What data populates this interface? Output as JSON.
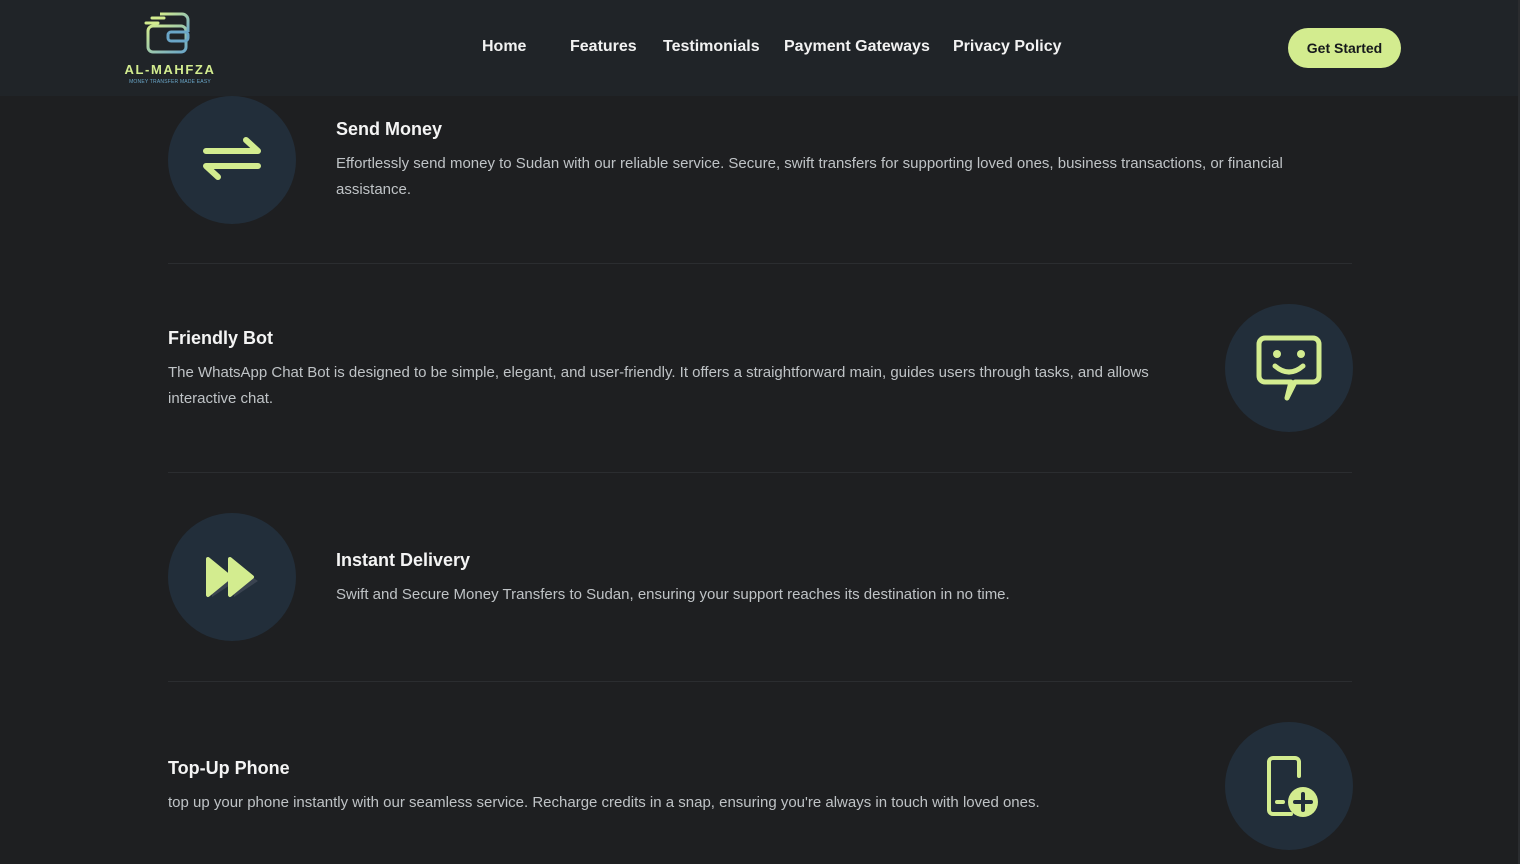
{
  "brand": {
    "name": "AL-MAHFZA",
    "tagline": "MONEY TRANSFER MADE EASY",
    "accent_color": "#d3ec8f",
    "secondary_color": "#6aa6c8"
  },
  "nav": {
    "items": [
      {
        "label": "Home"
      },
      {
        "label": "Features"
      },
      {
        "label": "Testimonials"
      },
      {
        "label": "Payment Gateways"
      },
      {
        "label": "Privacy Policy"
      }
    ],
    "cta_label": "Get Started"
  },
  "features": [
    {
      "title": "Send Money",
      "description": "Effortlessly send money to Sudan with our reliable service. Secure, swift transfers for supporting loved ones, business transactions, or financial assistance.",
      "icon": "transfer-arrows-icon"
    },
    {
      "title": "Friendly Bot",
      "description": "The WhatsApp Chat Bot is designed to be simple, elegant, and user-friendly. It offers a straightforward main, guides users through tasks, and allows interactive chat.",
      "icon": "chat-bot-icon"
    },
    {
      "title": "Instant Delivery",
      "description": "Swift and Secure Money Transfers to Sudan, ensuring your support reaches its destination in no time.",
      "icon": "fast-forward-icon"
    },
    {
      "title": "Top-Up Phone",
      "description": "top up your phone instantly with our seamless service. Recharge credits in a snap, ensuring you're always in touch with loved ones.",
      "icon": "phone-topup-icon"
    }
  ]
}
